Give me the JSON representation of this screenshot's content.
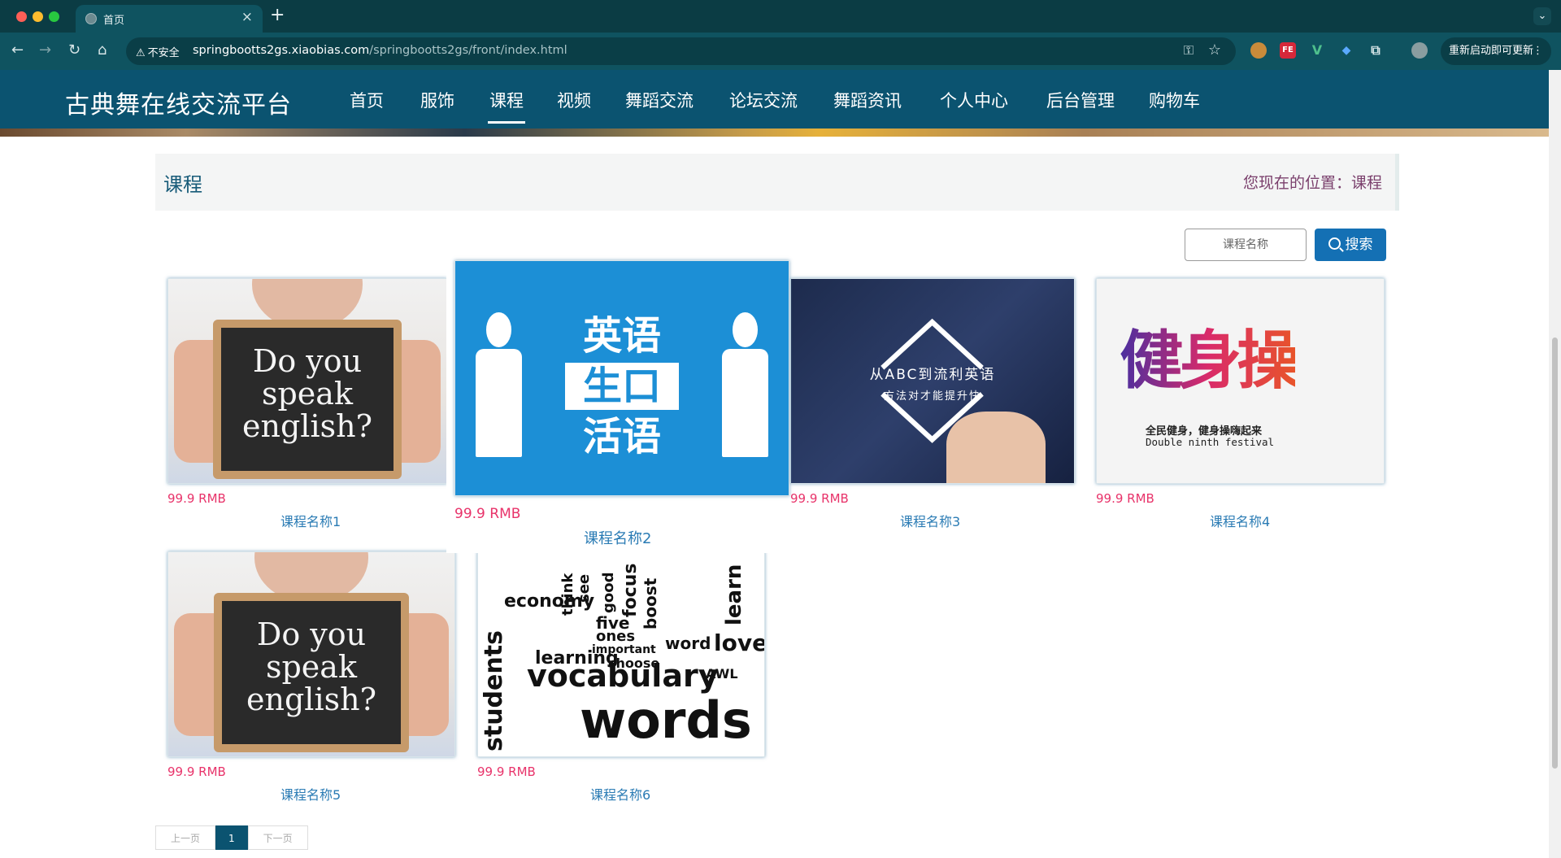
{
  "browser": {
    "tab_title": "首页",
    "tab_close": "×",
    "new_tab": "+",
    "tab_menu": "⌄",
    "insecure_label": "不安全",
    "url_host": "springbootts2gs.xiaobias.com",
    "url_path": "/springbootts2gs/front/index.html",
    "update_label": "重新启动即可更新",
    "update_menu": "⋮",
    "ext_fe": "FE",
    "ext_v": "V"
  },
  "site": {
    "title": "古典舞在线交流平台",
    "nav": [
      {
        "label": "首页"
      },
      {
        "label": "服饰"
      },
      {
        "label": "课程",
        "active": true
      },
      {
        "label": "视频"
      },
      {
        "label": "舞蹈交流"
      },
      {
        "label": "论坛交流"
      },
      {
        "label": "舞蹈资讯"
      },
      {
        "label": "个人中心"
      },
      {
        "label": "后台管理"
      },
      {
        "label": "购物车"
      }
    ]
  },
  "page_header": {
    "title": "课程",
    "breadcrumb": "您现在的位置：课程"
  },
  "search": {
    "placeholder": "课程名称",
    "button_label": "搜索"
  },
  "courses": [
    {
      "price": "99.9 RMB",
      "name": "课程名称1",
      "image": "do-you-speak-english-chalkboard",
      "image_text": [
        "Do you",
        "speak",
        "english?"
      ]
    },
    {
      "price": "99.9 RMB",
      "name": "课程名称2",
      "image": "english-spoken-blue-banner",
      "image_text": [
        "英语",
        "生口",
        "活语"
      ]
    },
    {
      "price": "99.9 RMB",
      "name": "课程名称3",
      "image": "student-writing-abc",
      "image_text": [
        "从ABC到流利英语",
        "方法对才能提升快"
      ]
    },
    {
      "price": "99.9 RMB",
      "name": "课程名称4",
      "image": "fitness-calligraphy",
      "image_text": [
        "健身操",
        "全民健身，健身操嗨起来",
        "Double ninth festival"
      ]
    },
    {
      "price": "99.9 RMB",
      "name": "课程名称5",
      "image": "do-you-speak-english-chalkboard",
      "image_text": [
        "Do you",
        "speak",
        "english?"
      ]
    },
    {
      "price": "99.9 RMB",
      "name": "课程名称6",
      "image": "vocabulary-word-cloud",
      "image_text": [
        "vocabulary",
        "words",
        "students",
        "learning",
        "economy",
        "love",
        "learn",
        "focus",
        "five",
        "ones",
        "word",
        "important",
        "choose",
        "AWL",
        "boost",
        "think",
        "see",
        "good"
      ]
    }
  ],
  "pagination": {
    "prev": "上一页",
    "current": "1",
    "next": "下一页"
  },
  "colors": {
    "navbar": "#0b5370",
    "price": "#e8336a",
    "course_name": "#2a7bb4",
    "search_button": "#1470b4",
    "breadcrumb": "#7a3f6c"
  }
}
